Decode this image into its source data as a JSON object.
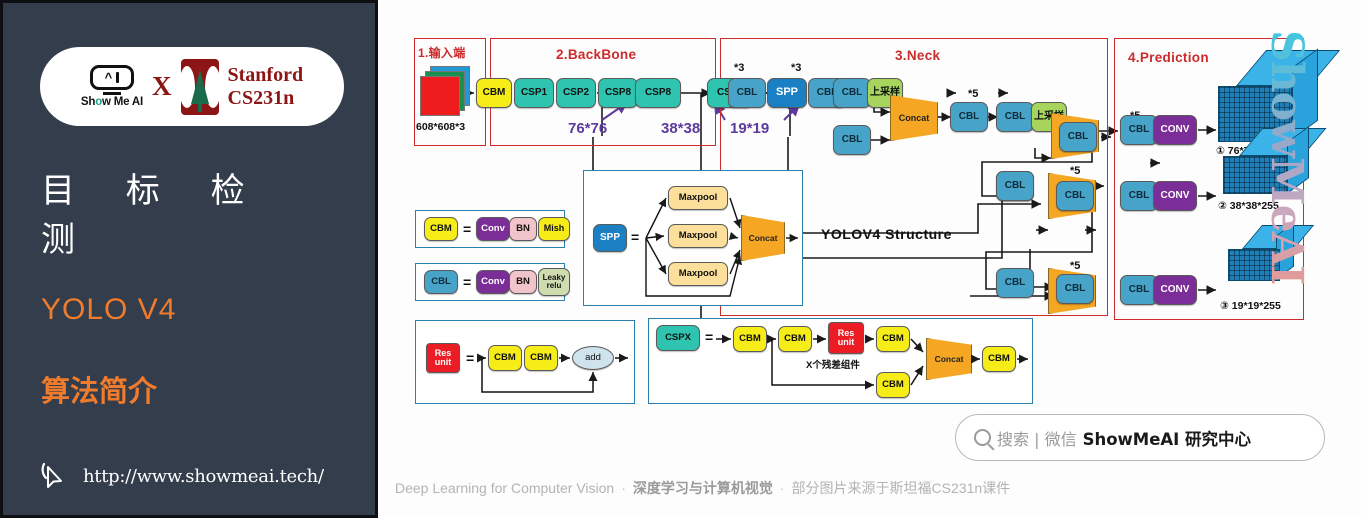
{
  "slide": {
    "brand": {
      "logo_word": "Show Me AI",
      "logo_word_prefix": "Sh",
      "logo_word_o": "o",
      "logo_word_suffix": "w Me AI",
      "cross": "X",
      "partner_line1": "Stanford",
      "partner_line2": "CS231n"
    },
    "title_cn": "目 标 检 测",
    "topic_en": "YOLO V4",
    "topic_cn": "算法简介",
    "url": "http://www.showmeai.tech/",
    "cursor_icon": "cursor-arrow-icon"
  },
  "search": {
    "icon": "search-icon",
    "gray_text": "搜索 | 微信",
    "bold_text": "ShowMeAI 研究中心"
  },
  "footer": {
    "en": "Deep Learning for Computer Vision",
    "dot1": "·",
    "cn_bold": "深度学习与计算机视觉",
    "dot2": "·",
    "cn_gray": "部分图片来源于斯坦福CS231n课件"
  },
  "watermark": "ShowMeAI",
  "diagram": {
    "caption": "YOLOV4 Structure",
    "sections": [
      {
        "id": "input",
        "title": "1.输入端"
      },
      {
        "id": "backbone",
        "title": "2.BackBone"
      },
      {
        "id": "neck",
        "title": "3.Neck"
      },
      {
        "id": "prediction",
        "title": "4.Prediction"
      }
    ],
    "input": {
      "size_label": "608*608*3",
      "sheet_colors": [
        "#1f9ad6",
        "#1b8f4e",
        "#ee1c1c"
      ]
    },
    "backbone": {
      "nodes": [
        "CBM",
        "CSP1",
        "CSP2",
        "CSP8",
        "CSP8",
        "CSP4"
      ],
      "scale_labels": [
        "76*76",
        "38*38",
        "19*19"
      ]
    },
    "neck": {
      "row_top": [
        "CBL",
        "SPP",
        "CBL",
        "CBL",
        "上采样"
      ],
      "multipliers": [
        "*3",
        "*3",
        "*5",
        "*5",
        "*5",
        "*5"
      ],
      "concat_label": "Concat",
      "cbl_label": "CBL",
      "upsample_label": "上采样"
    },
    "prediction": {
      "heads": [
        {
          "cbl": "CBL",
          "conv": "CONV",
          "out": "① 76*76*255"
        },
        {
          "cbl": "CBL",
          "conv": "CONV",
          "out": "② 38*38*255"
        },
        {
          "cbl": "CBL",
          "conv": "CONV",
          "out": "③ 19*19*255"
        }
      ]
    },
    "legend_cbm": {
      "name": "CBM",
      "eq": "=",
      "parts": [
        "Conv",
        "BN",
        "Mish"
      ]
    },
    "legend_cbl": {
      "name": "CBL",
      "eq": "=",
      "parts": [
        "Conv",
        "BN",
        "Leaky relu"
      ],
      "leaky_l1": "Leaky",
      "leaky_l2": "relu"
    },
    "legend_spp": {
      "name": "SPP",
      "eq": "=",
      "pools": [
        "Maxpool",
        "Maxpool",
        "Maxpool"
      ],
      "concat": "Concat"
    },
    "legend_res": {
      "name_l1": "Res",
      "name_l2": "unit",
      "eq": "=",
      "parts": [
        "CBM",
        "CBM"
      ],
      "add": "add"
    },
    "legend_cspx": {
      "name": "CSPX",
      "eq": "=",
      "parts": [
        "CBM",
        "CBM",
        "CBM",
        "CBM",
        "CBM"
      ],
      "res_l1": "Res",
      "res_l2": "unit",
      "note": "X个残差组件",
      "concat": "Concat"
    }
  },
  "colors": {
    "panel_bg": "#333d4b",
    "accent_orange": "#f07b2c",
    "section_red": "#cc2b2b",
    "stanford_red": "#8c1515",
    "cbm_yellow": "#f5ec18",
    "csp_teal": "#2ec4b0",
    "cbl_blue": "#47a3c8",
    "spp_blue": "#1b7fc4",
    "upsample_green": "#a6d45c",
    "conv_purple": "#7b2d98",
    "concat_orange": "#f5a623",
    "res_red": "#ec1c24",
    "purple_label": "#5c3a9e"
  }
}
